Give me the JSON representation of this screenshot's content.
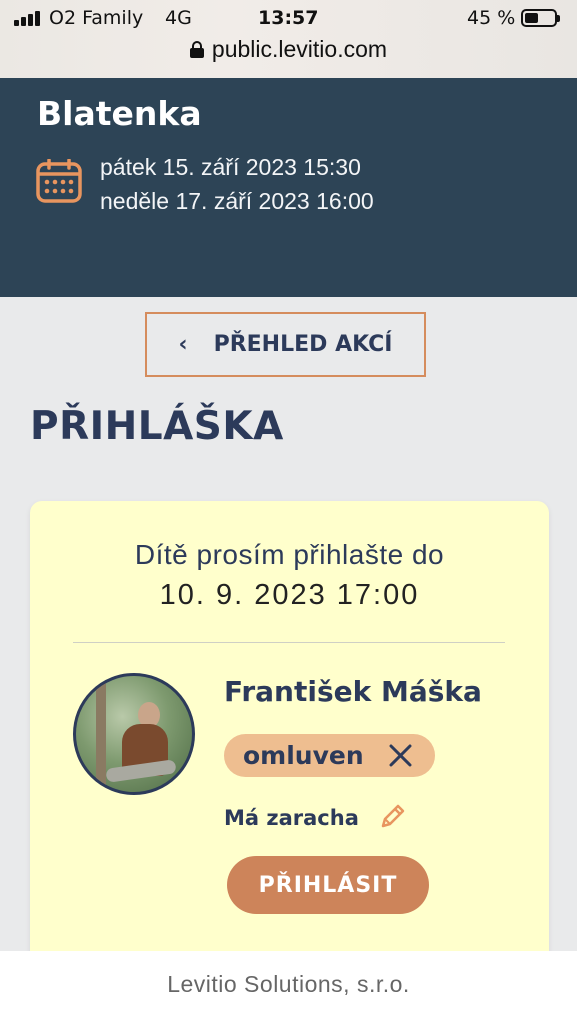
{
  "status_bar": {
    "carrier": "O2 Family",
    "network": "4G",
    "time": "13:57",
    "battery_percent": "45 %",
    "battery_level": 0.45
  },
  "browser": {
    "url": "public.levitio.com"
  },
  "event": {
    "title": "Blatenka",
    "start": "pátek 15. září 2023 15:30",
    "end": "neděle 17. září 2023 16:00",
    "icon": "calendar-icon"
  },
  "nav": {
    "back_label": "PŘEHLED AKCÍ",
    "back_icon": "chevron-left-icon"
  },
  "page": {
    "heading": "PŘIHLÁŠKA"
  },
  "registration": {
    "deadline_label": "Dítě prosím přihlašte do",
    "deadline_value": "10. 9. 2023 17:00",
    "child": {
      "name": "František Máška",
      "status": "omluven",
      "note": "Má zaracha",
      "signup_label": "PŘIHLÁSIT"
    }
  },
  "footer": {
    "text": "Levitio Solutions, s.r.o."
  },
  "colors": {
    "header_bg": "#2d4456",
    "accent": "#cd845a",
    "card_bg": "#ffffcc",
    "text_dark": "#2c3a5a",
    "badge_bg": "#eebe90"
  }
}
